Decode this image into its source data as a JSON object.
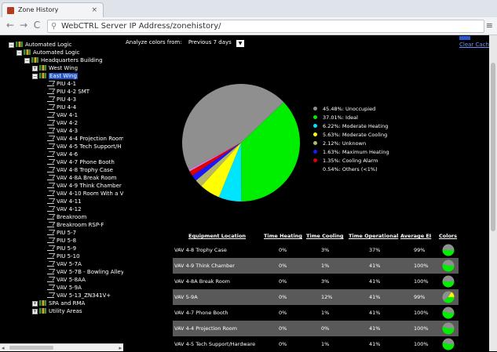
{
  "browser": {
    "tab_title": "Zone History",
    "tab_close": "×",
    "back": "←",
    "forward": "→",
    "reload": "C",
    "url": "WebCTRL Server IP Address/zonehistory/",
    "menu": "≡"
  },
  "tree": {
    "items": [
      {
        "label": "Automated Logic",
        "level": 0,
        "box": "−",
        "icon": "logic-icon"
      },
      {
        "label": "Automated Logic",
        "level": 1,
        "box": "−",
        "icon": "logic-icon"
      },
      {
        "label": "Headquarters Building",
        "level": 2,
        "box": "−",
        "icon": "logic-icon"
      },
      {
        "label": "West Wing",
        "level": 3,
        "box": "+",
        "icon": "logic-icon"
      },
      {
        "label": "East Wing",
        "level": 3,
        "box": "−",
        "icon": "logic-icon",
        "selected": true
      },
      {
        "label": "PIU 4-1",
        "level": 4,
        "icon": "device-icon"
      },
      {
        "label": "PIU 4-2 SMT",
        "level": 4,
        "icon": "device-icon"
      },
      {
        "label": "PIU 4-3",
        "level": 4,
        "icon": "device-icon"
      },
      {
        "label": "PIU 4-4",
        "level": 4,
        "icon": "device-icon"
      },
      {
        "label": "VAV 4-1",
        "level": 4,
        "icon": "device-icon"
      },
      {
        "label": "VAV 4-2",
        "level": 4,
        "icon": "device-icon"
      },
      {
        "label": "VAV 4-3",
        "level": 4,
        "icon": "device-icon"
      },
      {
        "label": "VAV 4-4 Projection Room",
        "level": 4,
        "icon": "device-icon"
      },
      {
        "label": "VAV 4-5 Tech Support/H",
        "level": 4,
        "icon": "device-icon"
      },
      {
        "label": "VAV 4-6",
        "level": 4,
        "icon": "device-icon"
      },
      {
        "label": "VAV 4-7 Phone Booth",
        "level": 4,
        "icon": "device-icon"
      },
      {
        "label": "VAV 4-8 Trophy Case",
        "level": 4,
        "icon": "device-icon"
      },
      {
        "label": "VAV 4-8A Break Room",
        "level": 4,
        "icon": "device-icon"
      },
      {
        "label": "VAV 4-9 Think Chamber",
        "level": 4,
        "icon": "device-icon"
      },
      {
        "label": "VAV 4-10 Room With a V",
        "level": 4,
        "icon": "device-icon"
      },
      {
        "label": "VAV 4-11",
        "level": 4,
        "icon": "device-icon"
      },
      {
        "label": "VAV 4-12",
        "level": 4,
        "icon": "device-icon"
      },
      {
        "label": "Breakroom",
        "level": 4,
        "icon": "device-icon"
      },
      {
        "label": "Breakroom RSP-F",
        "level": 4,
        "icon": "device-icon"
      },
      {
        "label": "PIU 5-7",
        "level": 4,
        "icon": "device-icon"
      },
      {
        "label": "PIU 5-8",
        "level": 4,
        "icon": "device-icon"
      },
      {
        "label": "PIU 5-9",
        "level": 4,
        "icon": "device-icon"
      },
      {
        "label": "PIU 5-10",
        "level": 4,
        "icon": "device-icon"
      },
      {
        "label": "VAV 5-7A",
        "level": 4,
        "icon": "device-icon"
      },
      {
        "label": "VAV 5-7B - Bowling Alley",
        "level": 4,
        "icon": "device-icon"
      },
      {
        "label": "VAV 5-8AA",
        "level": 4,
        "icon": "device-icon"
      },
      {
        "label": "VAV 5-9A",
        "level": 4,
        "icon": "device-icon"
      },
      {
        "label": "VAV 5-13_ZN341V+",
        "level": 4,
        "icon": "device-icon"
      },
      {
        "label": "SPA and RMA",
        "level": 3,
        "box": "+",
        "icon": "logic-icon"
      },
      {
        "label": "Utility Areas",
        "level": 3,
        "box": "+",
        "icon": "logic-icon"
      }
    ]
  },
  "controls": {
    "analyze_label": "Analyze colors from:",
    "range_value": "Previous 7 days",
    "dropdown_arrow": "▼",
    "clear_cache": "Clear Cache"
  },
  "chart_data": {
    "type": "pie",
    "slices": [
      {
        "label": "Unoccupied",
        "value": 45.48,
        "color": "#8f8f8f"
      },
      {
        "label": "Ideal",
        "value": 37.01,
        "color": "#00ee00"
      },
      {
        "label": "Moderate Heating",
        "value": 6.22,
        "color": "#00e5ff"
      },
      {
        "label": "Moderate Cooling",
        "value": 5.63,
        "color": "#ffff00"
      },
      {
        "label": "Unknown",
        "value": 2.12,
        "color": "#b7b76a"
      },
      {
        "label": "Maximum Heating",
        "value": 1.63,
        "color": "#1a1aff"
      },
      {
        "label": "Cooling Alarm",
        "value": 1.35,
        "color": "#e00000"
      },
      {
        "label": "Others (<1%)",
        "value": 0.54,
        "color": "#d47be0"
      }
    ],
    "legend_text": [
      "45.48%: Unoccupied",
      "37.01%: Ideal",
      "6.22%: Moderate Heating",
      "5.63%: Moderate Cooling",
      "2.12%: Unknown",
      "1.63%: Maximum Heating",
      "1.35%: Cooling Alarm",
      "0.54%: Others (<1%)"
    ],
    "legend_placement": "right"
  },
  "table": {
    "headers": [
      "Equipment Location",
      "Time Heating",
      "Time Cooling",
      "Time Operational",
      "Average EI",
      "Colors"
    ],
    "rows": [
      {
        "location": "VAV 4-8 Trophy Case",
        "heating": "0%",
        "cooling": "3%",
        "operational": "37%",
        "avg_ei": "99%",
        "mini_ideal": 0.5
      },
      {
        "location": "VAV 4-9 Think Chamber",
        "heating": "0%",
        "cooling": "1%",
        "operational": "41%",
        "avg_ei": "100%",
        "mini_ideal": 0.55
      },
      {
        "location": "VAV 4-8A Break Room",
        "heating": "0%",
        "cooling": "3%",
        "operational": "41%",
        "avg_ei": "100%",
        "mini_ideal": 0.5
      },
      {
        "location": "VAV 5-9A",
        "heating": "0%",
        "cooling": "12%",
        "operational": "41%",
        "avg_ei": "99%",
        "mini_ideal": 0.4
      },
      {
        "location": "VAV 4-7 Phone Booth",
        "heating": "0%",
        "cooling": "1%",
        "operational": "41%",
        "avg_ei": "100%",
        "mini_ideal": 0.55
      },
      {
        "location": "VAV 4-4 Projection Room",
        "heating": "0%",
        "cooling": "0%",
        "operational": "41%",
        "avg_ei": "100%",
        "mini_ideal": 0.55
      },
      {
        "location": "VAV 4-5 Tech Support/Hardware",
        "heating": "0%",
        "cooling": "1%",
        "operational": "41%",
        "avg_ei": "100%",
        "mini_ideal": 0.55
      }
    ]
  }
}
